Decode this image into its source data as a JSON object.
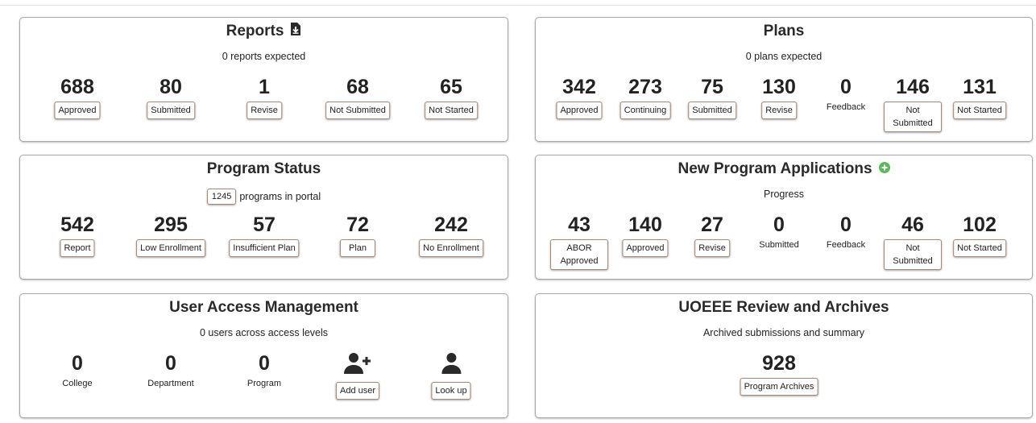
{
  "reports": {
    "title": "Reports",
    "subtitle": "0 reports expected",
    "stats": [
      {
        "value": "688",
        "label": "Approved"
      },
      {
        "value": "80",
        "label": "Submitted"
      },
      {
        "value": "1",
        "label": "Revise"
      },
      {
        "value": "68",
        "label": "Not Submitted"
      },
      {
        "value": "65",
        "label": "Not Started"
      }
    ]
  },
  "plans": {
    "title": "Plans",
    "subtitle": "0 plans expected",
    "stats": [
      {
        "value": "342",
        "label": "Approved"
      },
      {
        "value": "273",
        "label": "Continuing"
      },
      {
        "value": "75",
        "label": "Submitted"
      },
      {
        "value": "130",
        "label": "Revise"
      },
      {
        "value": "0",
        "label": "Feedback"
      },
      {
        "value": "146",
        "label": "Not Submitted"
      },
      {
        "value": "131",
        "label": "Not Started"
      }
    ]
  },
  "program_status": {
    "title": "Program Status",
    "count": "1245",
    "subtitle_suffix": "programs in portal",
    "stats": [
      {
        "value": "542",
        "label": "Report"
      },
      {
        "value": "295",
        "label": "Low Enrollment"
      },
      {
        "value": "57",
        "label": "Insufficient Plan"
      },
      {
        "value": "72",
        "label": "Plan"
      },
      {
        "value": "242",
        "label": "No Enrollment"
      }
    ]
  },
  "new_programs": {
    "title": "New Program Applications",
    "subtitle": "Progress",
    "stats": [
      {
        "value": "43",
        "label": "ABOR Approved"
      },
      {
        "value": "140",
        "label": "Approved"
      },
      {
        "value": "27",
        "label": "Revise"
      },
      {
        "value": "0",
        "label": "Submitted"
      },
      {
        "value": "0",
        "label": "Feedback"
      },
      {
        "value": "46",
        "label": "Not Submitted"
      },
      {
        "value": "102",
        "label": "Not Started"
      }
    ]
  },
  "user_access": {
    "title": "User Access Management",
    "subtitle": "0 users across access levels",
    "stats": [
      {
        "value": "0",
        "label": "College"
      },
      {
        "value": "0",
        "label": "Department"
      },
      {
        "value": "0",
        "label": "Program"
      }
    ],
    "add_user_label": "Add user",
    "lookup_label": "Look up",
    "icons": {
      "add_user": "add-user-icon",
      "lookup": "person-icon"
    }
  },
  "archives": {
    "title": "UOEEE Review and Archives",
    "subtitle": "Archived submissions and summary",
    "value": "928",
    "button_label": "Program Archives"
  },
  "icons": {
    "download": "download-icon",
    "add": "plus-circle-icon"
  },
  "colors": {
    "accent_green": "#5cb85c",
    "button_border": "#a58a78"
  }
}
